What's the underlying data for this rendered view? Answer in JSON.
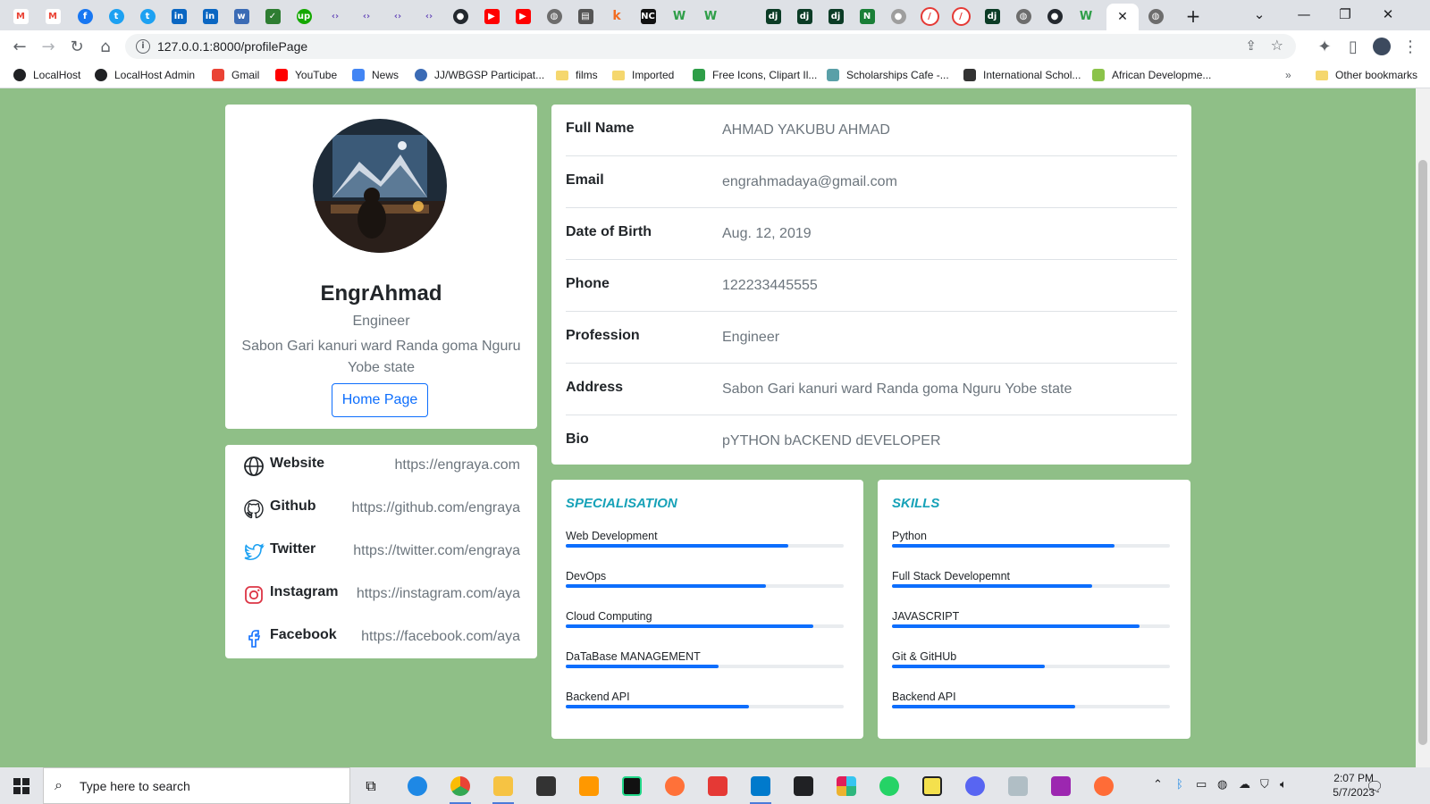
{
  "browser": {
    "url": "127.0.0.1:8000/profilePage",
    "bookmarks": [
      {
        "label": "LocalHost",
        "color": "#202124"
      },
      {
        "label": "LocalHost Admin",
        "color": "#202124"
      },
      {
        "label": "Gmail",
        "color": "#ea4335"
      },
      {
        "label": "YouTube",
        "color": "#ff0000"
      },
      {
        "label": "News",
        "color": "#4285f4"
      },
      {
        "label": "JJ/WBGSP Participat...",
        "color": "#3b6bb5"
      },
      {
        "label": "films",
        "color": "#f5d76e"
      },
      {
        "label": "Imported",
        "color": "#f5d76e"
      },
      {
        "label": "Free Icons, Clipart Il...",
        "color": "#2e9e48"
      },
      {
        "label": "Scholarships Cafe -...",
        "color": "#5aa0a8"
      },
      {
        "label": "International Schol...",
        "color": "#333333"
      },
      {
        "label": "African Developme...",
        "color": "#8bc34a"
      }
    ],
    "other_bookmarks": "Other bookmarks"
  },
  "profile": {
    "username": "EngrAhmad",
    "role": "Engineer",
    "address": "Sabon Gari kanuri ward Randa goma Nguru Yobe state",
    "home_button": "Home Page"
  },
  "social": [
    {
      "icon": "globe-icon",
      "label": "Website",
      "value": "https://engraya.com"
    },
    {
      "icon": "github-icon",
      "label": "Github",
      "value": "https://github.com/engraya"
    },
    {
      "icon": "twitter-icon",
      "label": "Twitter",
      "value": "https://twitter.com/engraya"
    },
    {
      "icon": "instagram-icon",
      "label": "Instagram",
      "value": "https://instagram.com/aya"
    },
    {
      "icon": "facebook-icon",
      "label": "Facebook",
      "value": "https://facebook.com/aya"
    }
  ],
  "details": [
    {
      "label": "Full Name",
      "value": "AHMAD YAKUBU AHMAD"
    },
    {
      "label": "Email",
      "value": "engrahmadaya@gmail.com"
    },
    {
      "label": "Date of Birth",
      "value": "Aug. 12, 2019"
    },
    {
      "label": "Phone",
      "value": "122233445555"
    },
    {
      "label": "Profession",
      "value": "Engineer"
    },
    {
      "label": "Address",
      "value": "Sabon Gari kanuri ward Randa goma Nguru Yobe state"
    },
    {
      "label": "Bio",
      "value": "pYTHON bACKEND dEVELOPER"
    }
  ],
  "specialisation": {
    "title": "SPECIALISATION",
    "items": [
      {
        "name": "Web Development",
        "level": 0.8
      },
      {
        "name": "DevOps",
        "level": 0.72
      },
      {
        "name": "Cloud Computing",
        "level": 0.89
      },
      {
        "name": "DaTaBase MANAGEMENT",
        "level": 0.55
      },
      {
        "name": "Backend API",
        "level": 0.66
      }
    ]
  },
  "skills": {
    "title": "SKILLS",
    "items": [
      {
        "name": "Python",
        "level": 0.8
      },
      {
        "name": "Full Stack Developemnt",
        "level": 0.72
      },
      {
        "name": "JAVASCRIPT",
        "level": 0.89
      },
      {
        "name": "Git & GitHUb",
        "level": 0.55
      },
      {
        "name": "Backend API",
        "level": 0.66
      }
    ]
  },
  "taskbar": {
    "search_placeholder": "Type here to search",
    "time": "2:07 PM",
    "date": "5/7/2023"
  },
  "colors": {
    "page_background": "#8fbf87",
    "accent": "#0d6efd",
    "section_title": "#17a2b8"
  }
}
